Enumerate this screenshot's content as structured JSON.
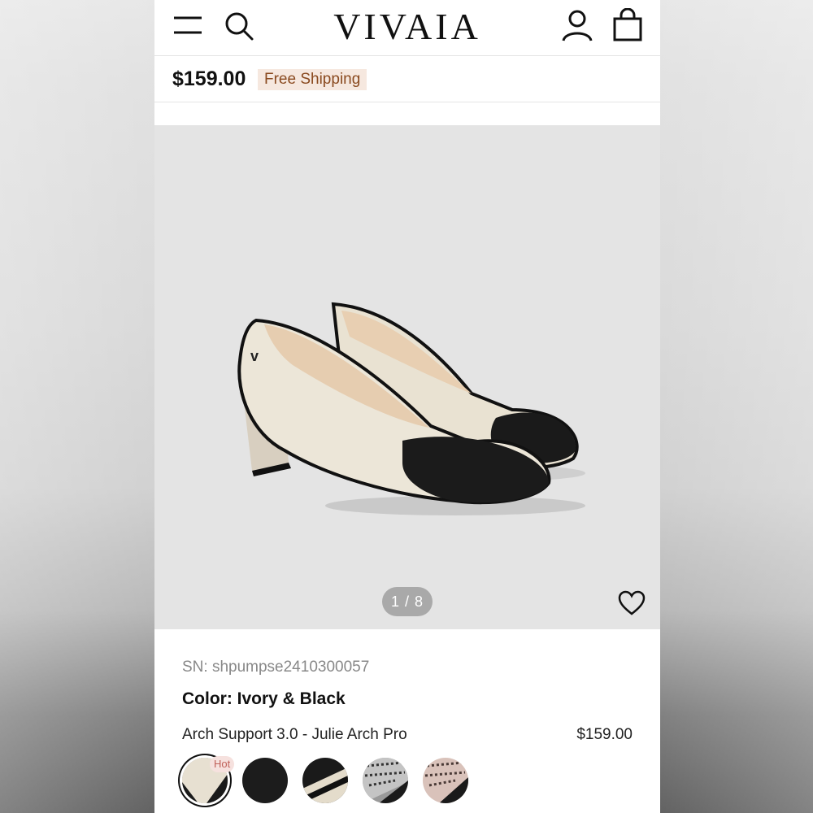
{
  "header": {
    "brand": "VIVAIA",
    "icons": [
      "menu-icon",
      "search-icon",
      "account-icon",
      "bag-icon"
    ]
  },
  "price_bar": {
    "price": "$159.00",
    "shipping_badge": "Free Shipping"
  },
  "gallery": {
    "counter": "1 / 8",
    "current_image": 1,
    "total_images": 8
  },
  "product": {
    "sn": "SN: shpumpse2410300057",
    "color_label": "Color: Ivory & Black",
    "variant_name": "Arch Support 3.0 - Julie Arch Pro",
    "variant_price": "$159.00",
    "hot_badge": "Hot",
    "swatches": [
      {
        "name": "Ivory & Black",
        "selected": true
      },
      {
        "name": "Black"
      },
      {
        "name": "Black & Ivory"
      },
      {
        "name": "Black & White Tweed"
      },
      {
        "name": "Pink & Black Tweed"
      }
    ]
  },
  "colors": {
    "free_shipping_bg": "#f6e8df",
    "free_shipping_text": "#8a4a1f",
    "gallery_bg": "#e4e4e4",
    "hot_text": "#c0615a"
  }
}
